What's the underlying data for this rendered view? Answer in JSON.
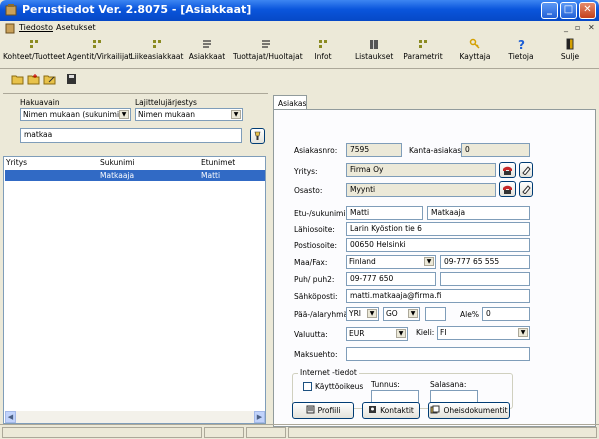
{
  "window": {
    "title": "Perustiedot Ver. 2.8075 - [Asiakkaat]",
    "minimize": "_",
    "maximize": "□",
    "close": "✕"
  },
  "menu": {
    "items": [
      "Tiedosto",
      "Asetukset"
    ],
    "mdi_controls": [
      "_",
      "▫",
      "✕"
    ]
  },
  "toolbar": {
    "items": [
      "Kohteet/Tuotteet",
      "Agentit/Virkailijat",
      "Liikeasiakkaat",
      "Asiakkaat",
      "Tuottajat/Huoltajat",
      "Infot",
      "Listaukset",
      "Parametrit",
      "Kayttaja",
      "Tietoja",
      "Sulje"
    ]
  },
  "search": {
    "hakuavain_label": "Hakuavain",
    "hakuavain_value": "Nimen mukaan (sukunimi + e",
    "lajittelu_label": "Lajittelujärjestys",
    "lajittelu_value": "Nimen mukaan",
    "query": "matkaa"
  },
  "list": {
    "columns": [
      "Yritys",
      "Sukunimi",
      "Etunimet"
    ],
    "rows": [
      {
        "yritys": "",
        "sukunimi": "Matkaaja",
        "etunimet": "Matti"
      }
    ]
  },
  "tabs": [
    "Asiakas"
  ],
  "form": {
    "asiakasnro_label": "Asiakasnro:",
    "asiakasnro": "7595",
    "kanta_label": "Kanta-asiakas:",
    "kanta": "0",
    "yritys_label": "Yritys:",
    "yritys": "Firma Oy",
    "osasto_label": "Osasto:",
    "osasto": "Myynti",
    "nimi_label": "Etu-/sukunimi:",
    "etunimi": "Matti",
    "sukunimi": "Matkaaja",
    "lahiosoite_label": "Lähiosoite:",
    "lahiosoite": "Larin Kyöstion tie 6",
    "postiosoite_label": "Postiosoite:",
    "postiosoite": "00650 Helsinki",
    "maa_label": "Maa/Fax:",
    "maa": "Finland",
    "fax": "09-777 65 555",
    "puh_label": "Puh/ puh2:",
    "puh": "09-777 650",
    "puh2": "",
    "email_label": "Sähköposti:",
    "email": "matti.matkaaja@firma.fi",
    "ryhma_label": "Pää-/alaryhmä:",
    "paaryhma": "YRI",
    "alaryhma": "GO",
    "ryhma_extra": "",
    "ale_label": "Ale%",
    "ale": "0",
    "valuutta_label": "Valuutta:",
    "valuutta": "EUR",
    "kieli_label": "Kieli:",
    "kieli": "FI",
    "maksuehto_label": "Maksuehto:",
    "maksuehto": "",
    "internet_label": "Internet -tiedot",
    "kayttooikeus_label": "Käyttöoikeus",
    "tunnus_label": "Tunnus:",
    "tunnus": "",
    "salasana_label": "Salasana:",
    "salasana": ""
  },
  "buttons": {
    "profiili": "Profiili",
    "kontaktit": "Kontaktit",
    "oheis": "Oheisdokumentit"
  },
  "colors": {
    "titlebar": "#0A55DC",
    "selection": "#316AC5",
    "face": "#ECE9D8"
  }
}
